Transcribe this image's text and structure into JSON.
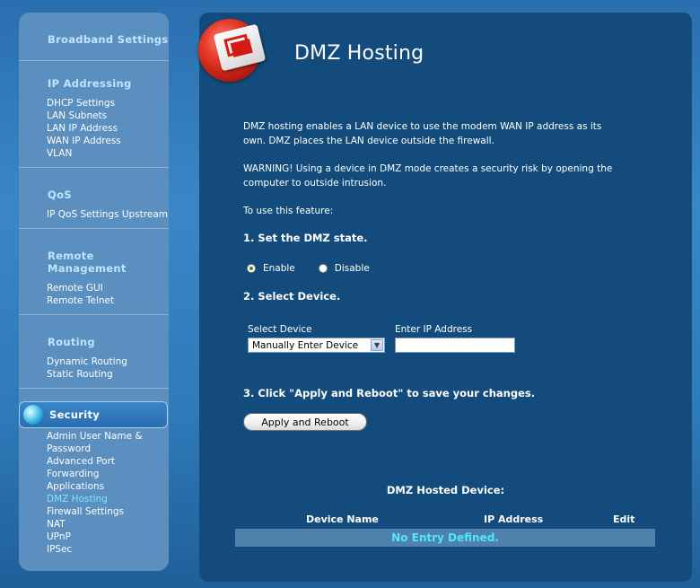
{
  "sidebar": {
    "broadband": {
      "title": "Broadband Settings"
    },
    "ip_addressing": {
      "title": "IP Addressing",
      "items": [
        "DHCP Settings",
        "LAN Subnets",
        "LAN IP Address",
        "WAN IP Address",
        "VLAN"
      ]
    },
    "qos": {
      "title": "QoS",
      "items": [
        "IP QoS Settings Upstream"
      ]
    },
    "remote": {
      "title_line1": "Remote",
      "title_line2": "Management",
      "items": [
        "Remote GUI",
        "Remote Telnet"
      ]
    },
    "routing": {
      "title": "Routing",
      "items": [
        "Dynamic Routing",
        "Static Routing"
      ]
    },
    "security": {
      "title": "Security",
      "items": [
        "Admin User Name &",
        "Password",
        "Advanced Port",
        "Forwarding",
        "Applications",
        "DMZ Hosting",
        "Firewall Settings",
        "NAT",
        "UPnP",
        "IPSec"
      ],
      "active": "DMZ Hosting"
    }
  },
  "main": {
    "title": "DMZ Hosting",
    "description_line1": "DMZ hosting enables a LAN device to use the modem WAN IP address as its",
    "description_line2": "own. DMZ places the LAN device outside the firewall.",
    "warning_line1": "WARNING! Using a device in DMZ mode creates a security risk by opening the",
    "warning_line2": "computer to outside intrusion.",
    "use_intro": "To use this feature:",
    "step1": "1. Set the DMZ state.",
    "enable_label": "Enable",
    "disable_label": "Disable",
    "dmz_state": "Enable",
    "step2": "2. Select Device.",
    "select_device_label": "Select Device",
    "select_device_value": "Manually Enter Device",
    "enter_ip_label": "Enter IP Address",
    "ip_value": "",
    "step3": "3. Click \"Apply and Reboot\" to save your changes.",
    "apply_button": "Apply and Reboot",
    "hosted_title": "DMZ Hosted Device:",
    "table": {
      "headers": [
        "Device Name",
        "IP Address",
        "Edit"
      ],
      "empty_message": "No Entry Defined."
    }
  },
  "colors": {
    "panel": "#134c7c",
    "sidebar": "#5b8fbf",
    "heading": "#bfe4ff",
    "active_link": "#7fe6ff",
    "empty_row_text": "#4fe8ff"
  },
  "icons": {
    "logo": "dmz-card-icon",
    "security": "globe-icon",
    "select_arrow": "chevron-down-icon"
  }
}
